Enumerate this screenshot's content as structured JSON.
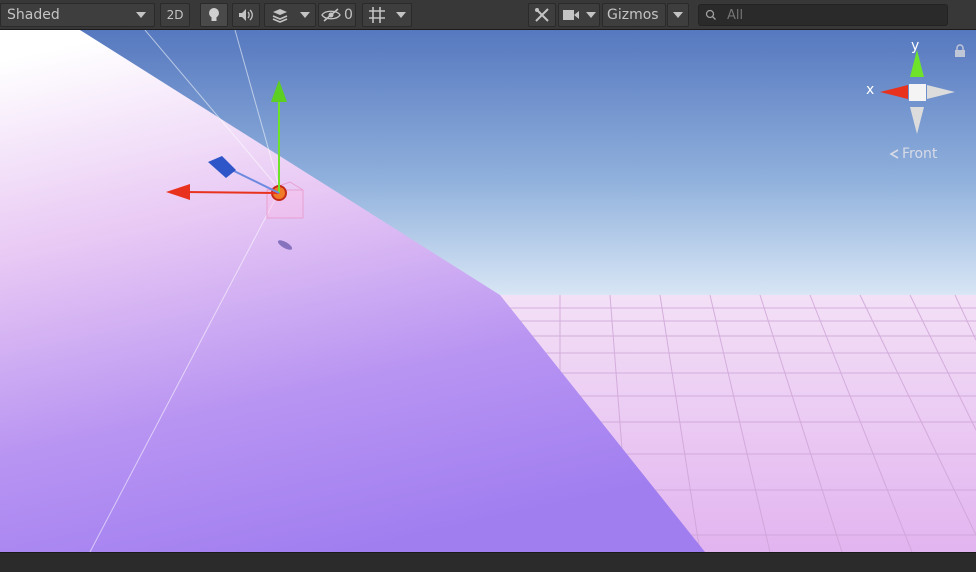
{
  "toolbar": {
    "shading_mode": "Shaded",
    "mode_2d": "2D",
    "hidden_count": "0",
    "gizmos_label": "Gizmos",
    "search_placeholder": "All"
  },
  "orientation_gizmo": {
    "x_label": "x",
    "y_label": "y",
    "view_label": "Front"
  },
  "colors": {
    "toolbar_bg": "#383838",
    "sky_top": "#5b7fc2",
    "sky_horizon": "#c8dbf0",
    "ground": "#ecc8f2",
    "ramp": "#b08cf2",
    "x_axis": "#e8321e",
    "y_axis": "#6ee32a",
    "z_axis": "#2f56c8"
  }
}
